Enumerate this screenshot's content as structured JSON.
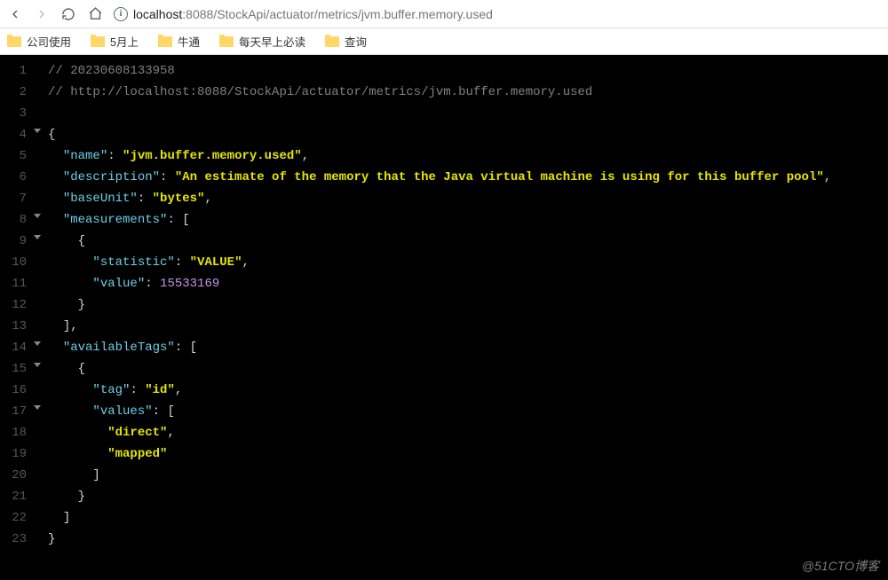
{
  "browser": {
    "url_host": "localhost",
    "url_port": ":8088",
    "url_path": "/StockApi/actuator/metrics/jvm.buffer.memory.used"
  },
  "bookmarks": {
    "items": [
      {
        "label": "公司使用"
      },
      {
        "label": "5月上"
      },
      {
        "label": "牛通"
      },
      {
        "label": "每天早上必读"
      },
      {
        "label": "查询"
      }
    ]
  },
  "code": {
    "comment_ts": "// 20230608133958",
    "comment_url": "// http://localhost:8088/StockApi/actuator/metrics/jvm.buffer.memory.used",
    "k_name": "\"name\"",
    "v_name": "\"jvm.buffer.memory.used\"",
    "k_description": "\"description\"",
    "v_description": "\"An estimate of the memory that the Java virtual machine is using for this buffer pool\"",
    "k_baseUnit": "\"baseUnit\"",
    "v_baseUnit": "\"bytes\"",
    "k_measurements": "\"measurements\"",
    "k_statistic": "\"statistic\"",
    "v_statistic": "\"VALUE\"",
    "k_value": "\"value\"",
    "v_value": "15533169",
    "k_availableTags": "\"availableTags\"",
    "k_tag": "\"tag\"",
    "v_tag": "\"id\"",
    "k_values": "\"values\"",
    "v_direct": "\"direct\"",
    "v_mapped": "\"mapped\"",
    "colon_sp": ": ",
    "open_brace": "{",
    "close_brace": "}",
    "open_bracket": "[",
    "close_bracket": "]",
    "comma": ","
  },
  "line_numbers": [
    "1",
    "2",
    "3",
    "4",
    "5",
    "6",
    "7",
    "8",
    "9",
    "10",
    "11",
    "12",
    "13",
    "14",
    "15",
    "16",
    "17",
    "18",
    "19",
    "20",
    "21",
    "22",
    "23"
  ],
  "folds": [
    4,
    8,
    9,
    14,
    15,
    17
  ],
  "watermark": "@51CTO博客"
}
